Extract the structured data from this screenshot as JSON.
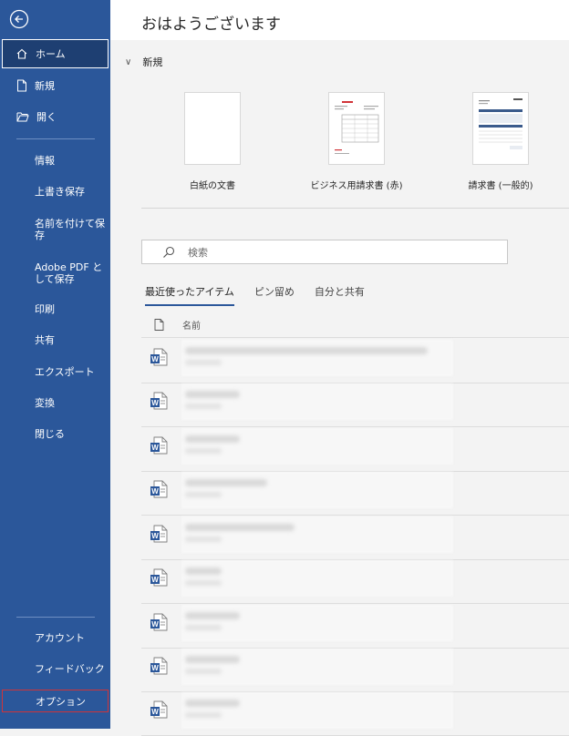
{
  "sidebar": {
    "top_items": [
      {
        "label": "ホーム",
        "icon": "home-icon"
      },
      {
        "label": "新規",
        "icon": "new-document-icon"
      },
      {
        "label": "開く",
        "icon": "folder-open-icon"
      }
    ],
    "sub_items": [
      "情報",
      "上書き保存",
      "名前を付けて保存",
      "Adobe PDF として保存",
      "印刷",
      "共有",
      "エクスポート",
      "変換",
      "閉じる"
    ],
    "bottom_items": [
      "アカウント",
      "フィードバック",
      "オプション"
    ]
  },
  "main": {
    "greeting": "おはようございます",
    "new_section": "新規",
    "templates": [
      "白紙の文書",
      "ビジネス用請求書 (赤)",
      "請求書 (一般的)"
    ],
    "search_placeholder": "検索",
    "tabs": [
      "最近使ったアイテム",
      "ピン留め",
      "自分と共有"
    ],
    "list_header": "名前"
  },
  "colors": {
    "sidebar": "#2b579a",
    "accent": "#2b579a",
    "highlight": "#d13438"
  }
}
